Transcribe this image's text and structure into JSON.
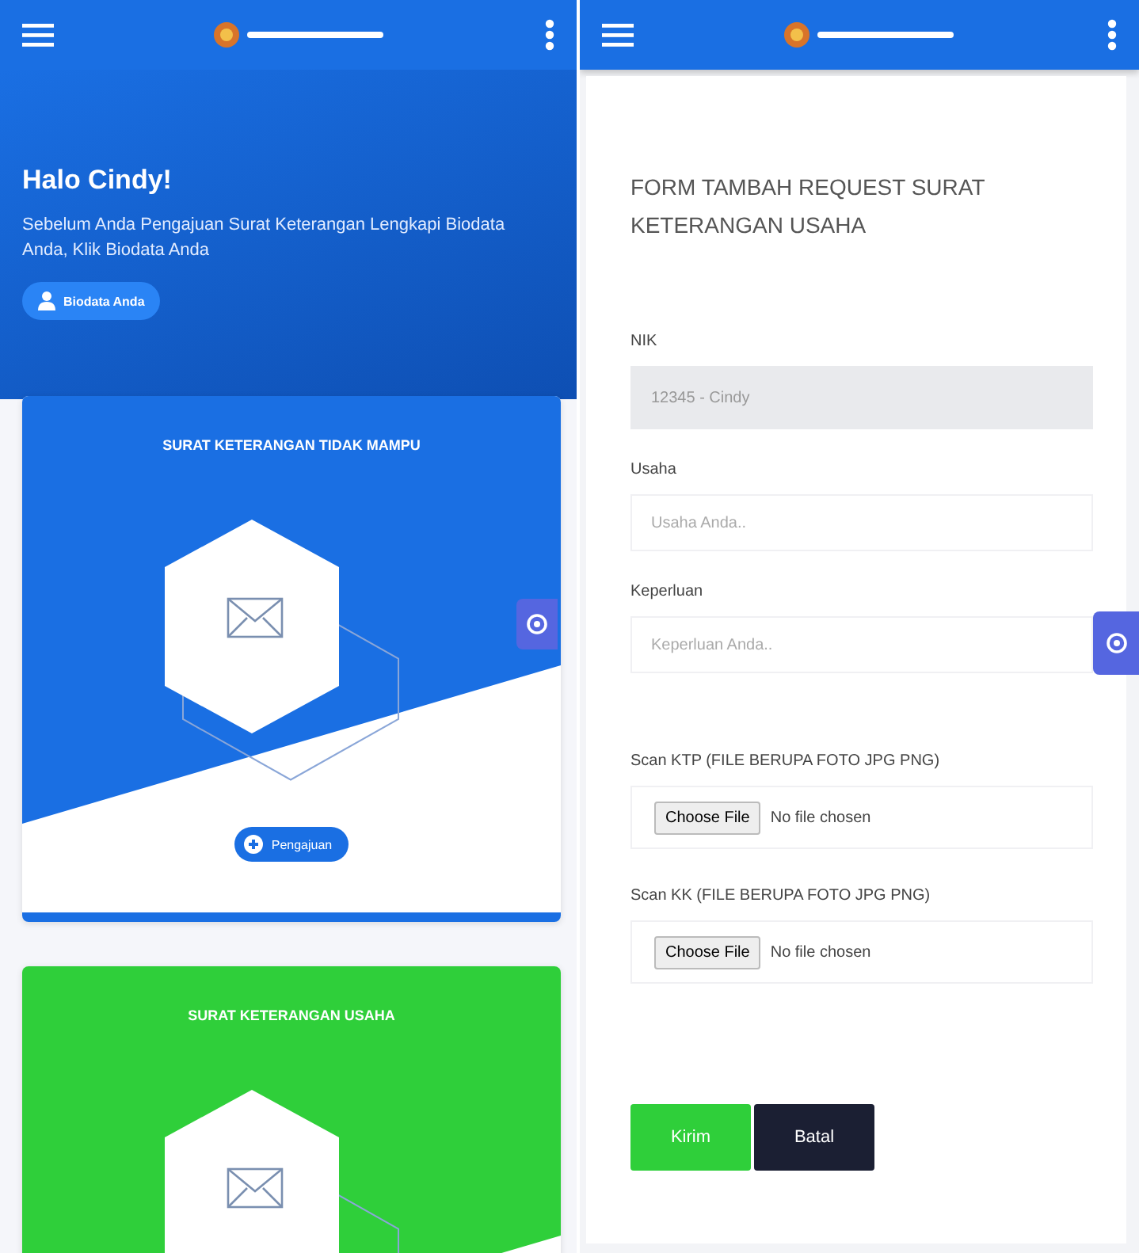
{
  "left_screen": {
    "hero": {
      "greeting": "Halo Cindy!",
      "message": "Sebelum Anda Pengajuan Surat Keterangan Lengkapi Biodata Anda, Klik Biodata Anda",
      "button": "Biodata Anda"
    },
    "cards": [
      {
        "title": "SURAT KETERANGAN TIDAK MAMPU",
        "color": "#1a6fe3",
        "button": "Pengajuan"
      },
      {
        "title": "SURAT KETERANGAN USAHA",
        "color": "#2fcf3a"
      }
    ]
  },
  "right_screen": {
    "form": {
      "title": "FORM TAMBAH REQUEST SURAT KETERANGAN USAHA",
      "fields": [
        {
          "kind": "text",
          "label": "NIK",
          "value": "12345 - Cindy",
          "disabled": true
        },
        {
          "kind": "text",
          "label": "Usaha",
          "placeholder": "Usaha Anda..",
          "disabled": false
        },
        {
          "kind": "text",
          "label": "Keperluan",
          "placeholder": "Keperluan Anda..",
          "disabled": false
        },
        {
          "kind": "file",
          "label": "Scan KTP (FILE BERUPA FOTO JPG PNG)",
          "button": "Choose File",
          "status": "No file chosen"
        },
        {
          "kind": "file",
          "label": "Scan KK (FILE BERUPA FOTO JPG PNG)",
          "button": "Choose File",
          "status": "No file chosen"
        }
      ],
      "buttons": [
        {
          "label": "Kirim",
          "kind": "submit"
        },
        {
          "label": "Batal",
          "kind": "cancel"
        }
      ]
    }
  }
}
